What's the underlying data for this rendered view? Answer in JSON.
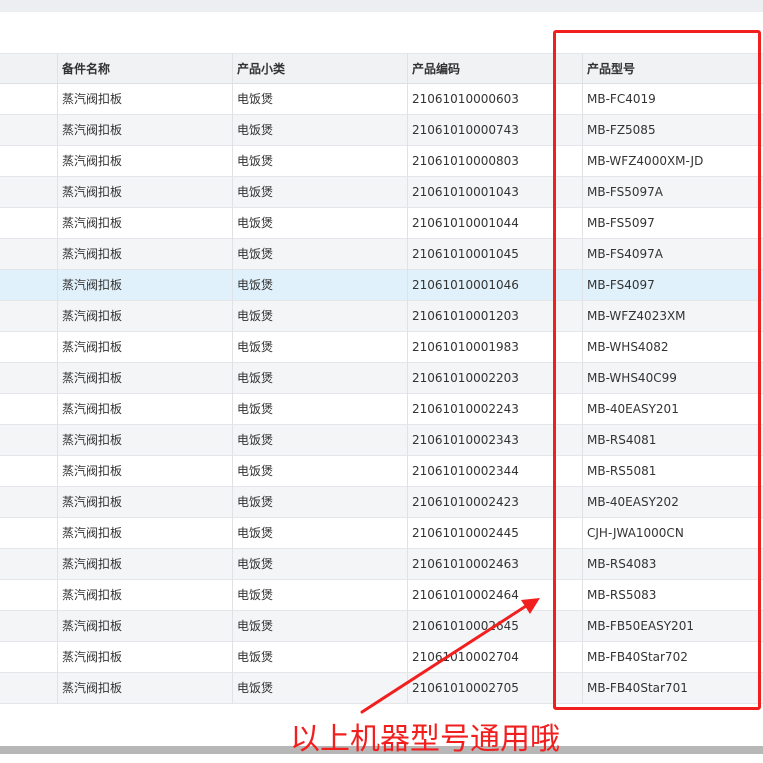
{
  "table": {
    "columns": [
      "",
      "备件名称",
      "产品小类",
      "产品编码",
      "产品型号"
    ],
    "rows": [
      [
        "",
        "蒸汽阀扣板",
        "电饭煲",
        "21061010000603",
        "MB-FC4019"
      ],
      [
        "",
        "蒸汽阀扣板",
        "电饭煲",
        "21061010000743",
        "MB-FZ5085"
      ],
      [
        "",
        "蒸汽阀扣板",
        "电饭煲",
        "21061010000803",
        "MB-WFZ4000XM-JD"
      ],
      [
        "",
        "蒸汽阀扣板",
        "电饭煲",
        "21061010001043",
        "MB-FS5097A"
      ],
      [
        "",
        "蒸汽阀扣板",
        "电饭煲",
        "21061010001044",
        "MB-FS5097"
      ],
      [
        "",
        "蒸汽阀扣板",
        "电饭煲",
        "21061010001045",
        "MB-FS4097A"
      ],
      [
        "",
        "蒸汽阀扣板",
        "电饭煲",
        "21061010001046",
        "MB-FS4097"
      ],
      [
        "",
        "蒸汽阀扣板",
        "电饭煲",
        "21061010001203",
        "MB-WFZ4023XM"
      ],
      [
        "",
        "蒸汽阀扣板",
        "电饭煲",
        "21061010001983",
        "MB-WHS4082"
      ],
      [
        "",
        "蒸汽阀扣板",
        "电饭煲",
        "21061010002203",
        "MB-WHS40C99"
      ],
      [
        "",
        "蒸汽阀扣板",
        "电饭煲",
        "21061010002243",
        "MB-40EASY201"
      ],
      [
        "",
        "蒸汽阀扣板",
        "电饭煲",
        "21061010002343",
        "MB-RS4081"
      ],
      [
        "",
        "蒸汽阀扣板",
        "电饭煲",
        "21061010002344",
        "MB-RS5081"
      ],
      [
        "",
        "蒸汽阀扣板",
        "电饭煲",
        "21061010002423",
        "MB-40EASY202"
      ],
      [
        "",
        "蒸汽阀扣板",
        "电饭煲",
        "21061010002445",
        "CJH-JWA1000CN"
      ],
      [
        "",
        "蒸汽阀扣板",
        "电饭煲",
        "21061010002463",
        "MB-RS4083"
      ],
      [
        "",
        "蒸汽阀扣板",
        "电饭煲",
        "21061010002464",
        "MB-RS5083"
      ],
      [
        "",
        "蒸汽阀扣板",
        "电饭煲",
        "21061010002645",
        "MB-FB50EASY201"
      ],
      [
        "",
        "蒸汽阀扣板",
        "电饭煲",
        "21061010002704",
        "MB-FB40Star702"
      ],
      [
        "",
        "蒸汽阀扣板",
        "电饭煲",
        "21061010002705",
        "MB-FB40Star701"
      ]
    ],
    "selected_row": 6
  },
  "annotation": {
    "text": "以上机器型号通用哦",
    "color": "#f21f1f"
  },
  "colors": {
    "row_alt": "#f4f5f7",
    "row_selected": "#e1f1fb",
    "header_bg": "#f1f2f4"
  }
}
